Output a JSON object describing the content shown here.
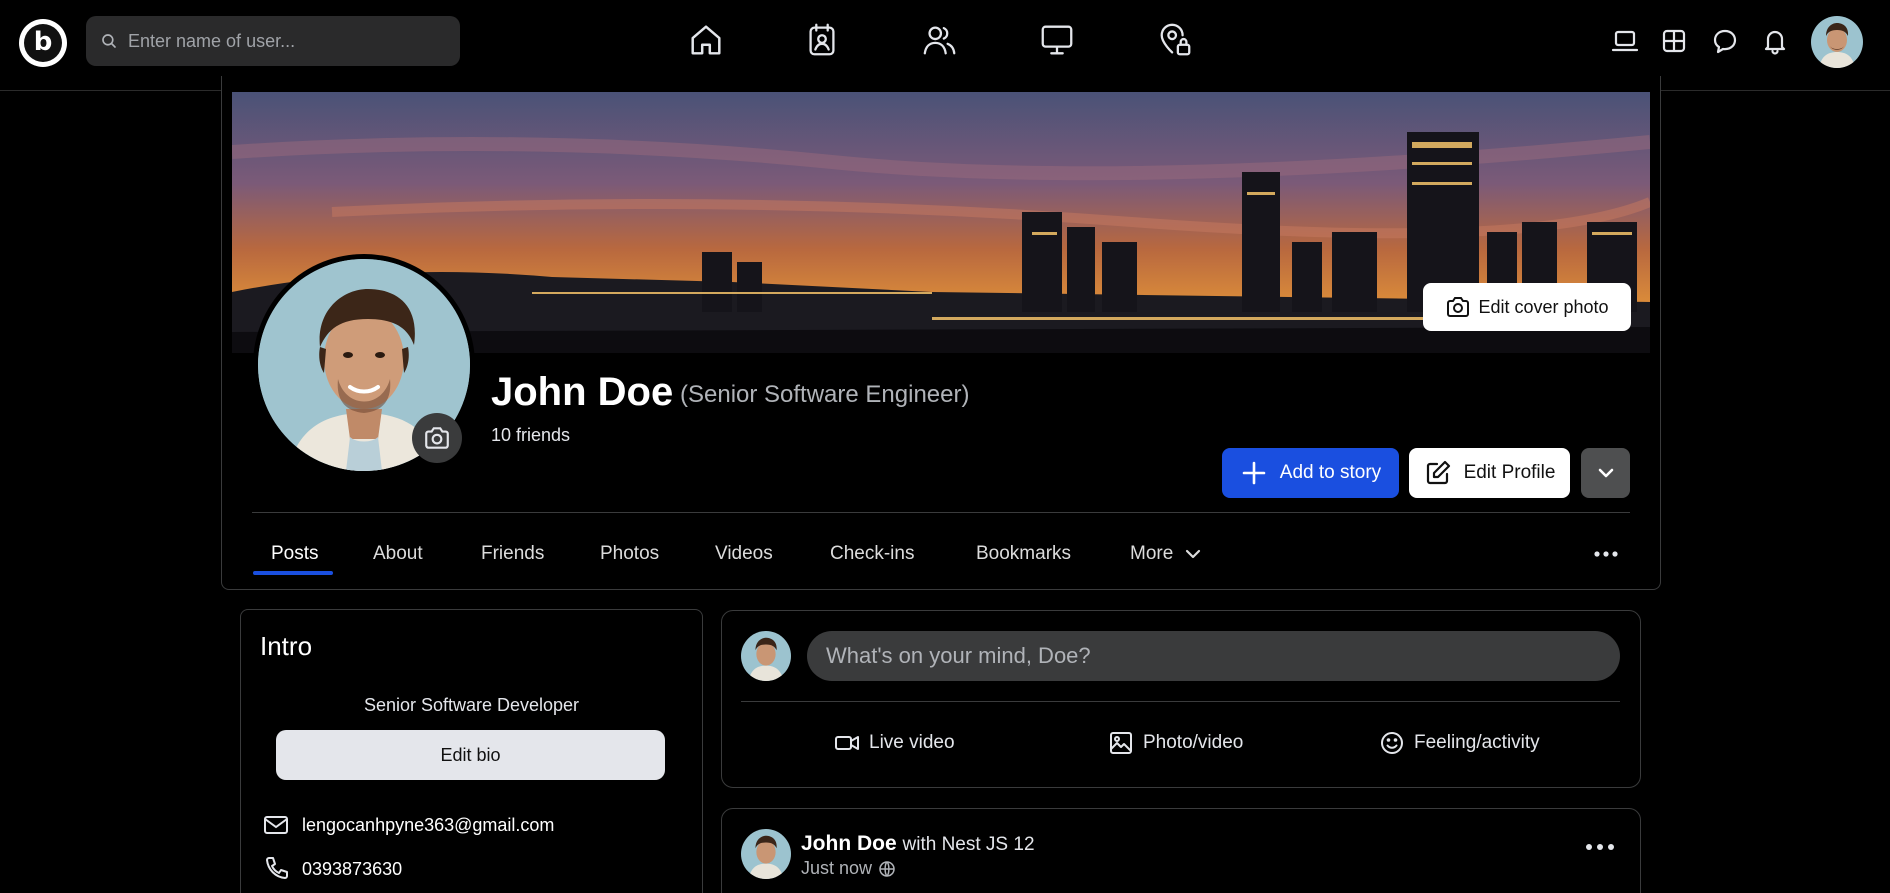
{
  "topbar": {
    "logo_letter": "b",
    "search_placeholder": "Enter name of user...",
    "nav_icons": [
      "home-icon",
      "contacts-book-icon",
      "friends-icon",
      "watch-monitor-icon",
      "location-lock-icon"
    ],
    "right_icons": [
      "laptop-icon",
      "grid-menu-icon",
      "messenger-icon",
      "bell-icon"
    ]
  },
  "profile": {
    "name": "John Doe",
    "job_title": "(Senior Software Engineer)",
    "friends_count": "10 friends",
    "edit_cover_label": "Edit cover photo",
    "add_story_label": "Add to story",
    "edit_profile_label": "Edit Profile",
    "accent": "#1a4fe0"
  },
  "tabs": [
    {
      "label": "Posts",
      "active": true
    },
    {
      "label": "About"
    },
    {
      "label": "Friends"
    },
    {
      "label": "Photos"
    },
    {
      "label": "Videos"
    },
    {
      "label": "Check-ins"
    },
    {
      "label": "Bookmarks"
    },
    {
      "label": "More"
    }
  ],
  "intro": {
    "title": "Intro",
    "bio": "Senior Software Developer",
    "edit_bio_label": "Edit bio",
    "email": "lengocanhpyne363@gmail.com",
    "phone": "0393873630"
  },
  "composer": {
    "placeholder": "What's on your mind, Doe?",
    "actions": [
      "Live video",
      "Photo/video",
      "Feeling/activity"
    ]
  },
  "post": {
    "author": "John Doe",
    "with_text": "with Nest JS 12",
    "time": "Just now"
  }
}
